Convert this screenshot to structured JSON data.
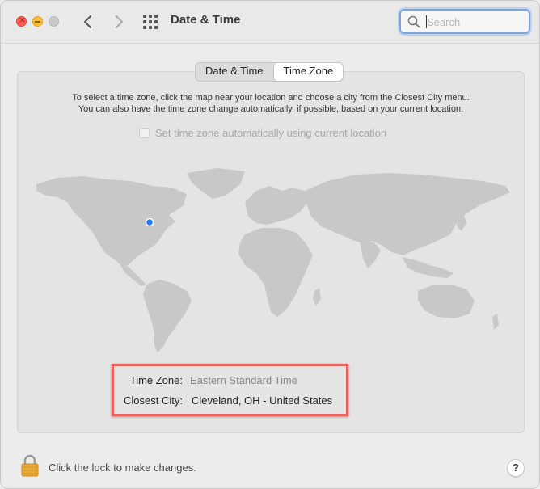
{
  "window": {
    "title": "Date & Time"
  },
  "toolbar": {
    "back_icon": "chevron-left-icon",
    "forward_icon": "chevron-right-icon",
    "grid_icon": "show-all-grid-icon"
  },
  "search": {
    "placeholder": "Search",
    "value": ""
  },
  "tabs": [
    {
      "label": "Date & Time",
      "active": false
    },
    {
      "label": "Time Zone",
      "active": true
    }
  ],
  "panel": {
    "instructions_line1": "To select a time zone, click the map near your location and choose a city from the Closest City menu.",
    "instructions_line2": "You can also have the time zone change automatically, if possible, based on your current location.",
    "auto_checkbox_label": "Set time zone automatically using current location",
    "auto_checkbox_checked": false,
    "time_zone_label": "Time Zone:",
    "time_zone_value": "Eastern Standard Time",
    "closest_city_label": "Closest City:",
    "closest_city_value": "Cleveland, OH - United States"
  },
  "footer": {
    "lock_text": "Click the lock to make changes.",
    "help_label": "?"
  },
  "colors": {
    "highlight_border": "#e8605a",
    "location_dot": "#1f7cf5",
    "map_land": "#c8c8c8"
  }
}
